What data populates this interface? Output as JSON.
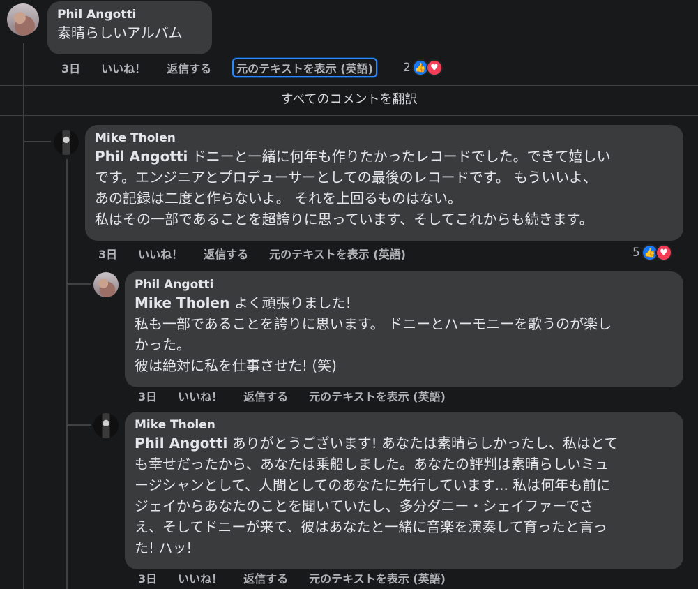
{
  "actions": {
    "time": "3日",
    "like": "いいね！",
    "reply": "返信する",
    "see_original": "元のテキストを表示 (英語)"
  },
  "translate_all": "すべてのコメントを翻訳",
  "comments": [
    {
      "author": "Phil Angotti",
      "text": "素晴らしいアルバム",
      "reaction_count": "2"
    },
    {
      "author": "Mike Tholen",
      "mention": "Phil Angotti",
      "lines": [
        "ドニーと一緒に何年も作りたかったレコードでした。できて嬉しい",
        "です。エンジニアとプロデューサーとしての最後のレコードです。 もういいよ、",
        "あの記録は二度と作らないよ。 それを上回るものはない。",
        "私はその一部であることを超誇りに思っています、そしてこれからも続きます。"
      ],
      "reaction_count": "5"
    },
    {
      "author": "Phil Angotti",
      "mention": "Mike Tholen",
      "lines": [
        "よく頑張りました!",
        "私も一部であることを誇りに思います。 ドニーとハーモニーを歌うのが楽し",
        "かった。",
        "彼は絶対に私を仕事させた! (笑)"
      ]
    },
    {
      "author": "Mike Tholen",
      "mention": "Phil Angotti",
      "lines": [
        "ありがとうございます! あなたは素晴らしかったし、私はとて",
        "も幸せだったから、あなたは乗船しました。あなたの評判は素晴らしいミュ",
        "ージシャンとして、人間としてのあなたに先行しています... 私は何年も前に",
        "ジェイからあなたのことを聞いていたし、多分ダニー・シェイファーでさ",
        "え、そしてドニーが来て、彼はあなたと一緒に音楽を演奏して育ったと言っ",
        "た! ハッ!"
      ]
    }
  ]
}
